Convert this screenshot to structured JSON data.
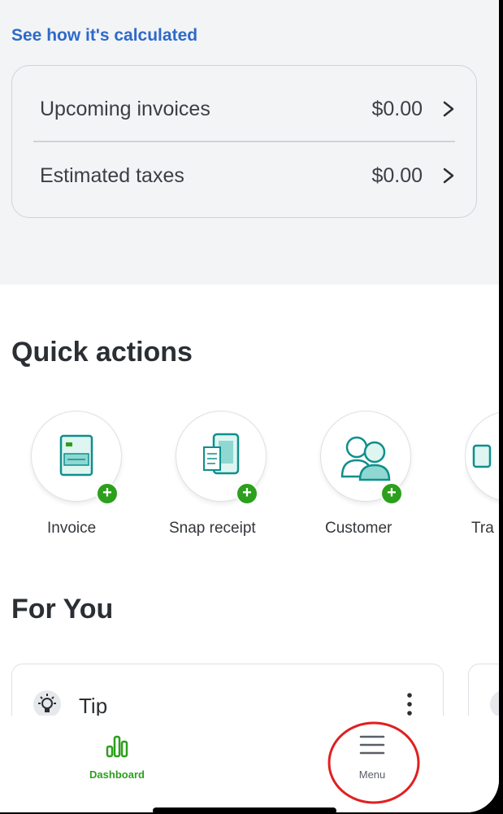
{
  "summary": {
    "calc_link": "See how it's calculated",
    "rows": [
      {
        "label": "Upcoming invoices",
        "amount": "$0.00"
      },
      {
        "label": "Estimated taxes",
        "amount": "$0.00"
      }
    ]
  },
  "quick_actions": {
    "title": "Quick actions",
    "items": [
      {
        "label": "Invoice",
        "icon": "invoice-icon"
      },
      {
        "label": "Snap receipt",
        "icon": "snap-receipt-icon"
      },
      {
        "label": "Customer",
        "icon": "customer-icon"
      },
      {
        "label": "Tra",
        "icon": "transaction-icon"
      }
    ]
  },
  "for_you": {
    "title": "For You",
    "card_label": "Tip",
    "card_icon": "lightbulb-icon"
  },
  "tabbar": {
    "dashboard_label": "Dashboard",
    "menu_label": "Menu"
  },
  "colors": {
    "link": "#2d6ac9",
    "accent_green": "#2ca01c",
    "annotation_red": "#e02020"
  }
}
